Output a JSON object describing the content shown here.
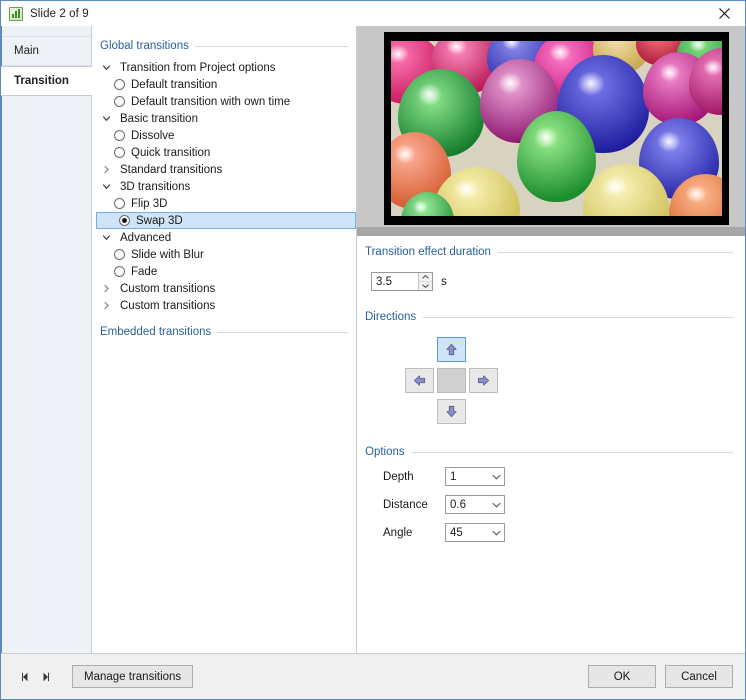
{
  "window": {
    "title": "Slide 2 of 9",
    "app_icon": "chart-bars-icon",
    "close_label": "✕"
  },
  "tabs": [
    {
      "label": "Main",
      "active": false
    },
    {
      "label": "Transition",
      "active": true
    }
  ],
  "tree_panel": {
    "global_group": "Global transitions",
    "embedded_group": "Embedded transitions",
    "items": [
      {
        "label": "Transition from Project options",
        "type": "group",
        "expanded": true,
        "indent": 1
      },
      {
        "label": "Default transition",
        "type": "radio",
        "selected": false,
        "indent": 2
      },
      {
        "label": "Default transition with own time",
        "type": "radio",
        "selected": false,
        "indent": 2
      },
      {
        "label": "Basic transition",
        "type": "group",
        "expanded": true,
        "indent": 1
      },
      {
        "label": "Dissolve",
        "type": "radio",
        "selected": false,
        "indent": 2
      },
      {
        "label": "Quick transition",
        "type": "radio",
        "selected": false,
        "indent": 2
      },
      {
        "label": "Standard transitions",
        "type": "group",
        "expanded": false,
        "indent": 1
      },
      {
        "label": "3D transitions",
        "type": "group",
        "expanded": true,
        "indent": 1
      },
      {
        "label": "Flip 3D",
        "type": "radio",
        "selected": false,
        "indent": 2
      },
      {
        "label": "Swap 3D",
        "type": "radio",
        "selected": true,
        "indent": 2
      },
      {
        "label": "Advanced",
        "type": "group",
        "expanded": true,
        "indent": 1
      },
      {
        "label": "Slide with Blur",
        "type": "radio",
        "selected": false,
        "indent": 2
      },
      {
        "label": "Fade",
        "type": "radio",
        "selected": false,
        "indent": 2
      },
      {
        "label": "Custom transitions",
        "type": "group",
        "expanded": false,
        "indent": 1
      },
      {
        "label": "Custom transitions",
        "type": "group",
        "expanded": false,
        "indent": 1
      }
    ]
  },
  "preview": {
    "image_name": "balloons-photo",
    "scrollbar_position": "left"
  },
  "duration": {
    "section_title": "Transition effect duration",
    "value": "3.5",
    "unit": "s",
    "placeholder": "0.0"
  },
  "directions": {
    "section_title": "Directions",
    "buttons": [
      {
        "name": "direction-up",
        "glyph": "⬆",
        "selected": true
      },
      {
        "name": "direction-left",
        "glyph": "⬅",
        "selected": false
      },
      {
        "name": "direction-center",
        "glyph": "",
        "selected": false
      },
      {
        "name": "direction-right",
        "glyph": "➡",
        "selected": false
      },
      {
        "name": "direction-down",
        "glyph": "⬇",
        "selected": false
      }
    ]
  },
  "options": {
    "section_title": "Options",
    "rows": [
      {
        "label": "Depth",
        "value": "1",
        "name": "depth"
      },
      {
        "label": "Distance",
        "value": "0.6",
        "name": "distance"
      },
      {
        "label": "Angle",
        "value": "45",
        "name": "angle"
      }
    ]
  },
  "footer": {
    "prev_label": "◀",
    "next_label": "▶",
    "manage_label": "Manage transitions",
    "ok_label": "OK",
    "cancel_label": "Cancel"
  },
  "colors": {
    "accent_blue": "#2a6099",
    "selection_fill": "#cfe4f7",
    "selection_border": "#7aaedd",
    "window_border": "#5a8ac4",
    "panel_gray": "#eef1f5"
  }
}
